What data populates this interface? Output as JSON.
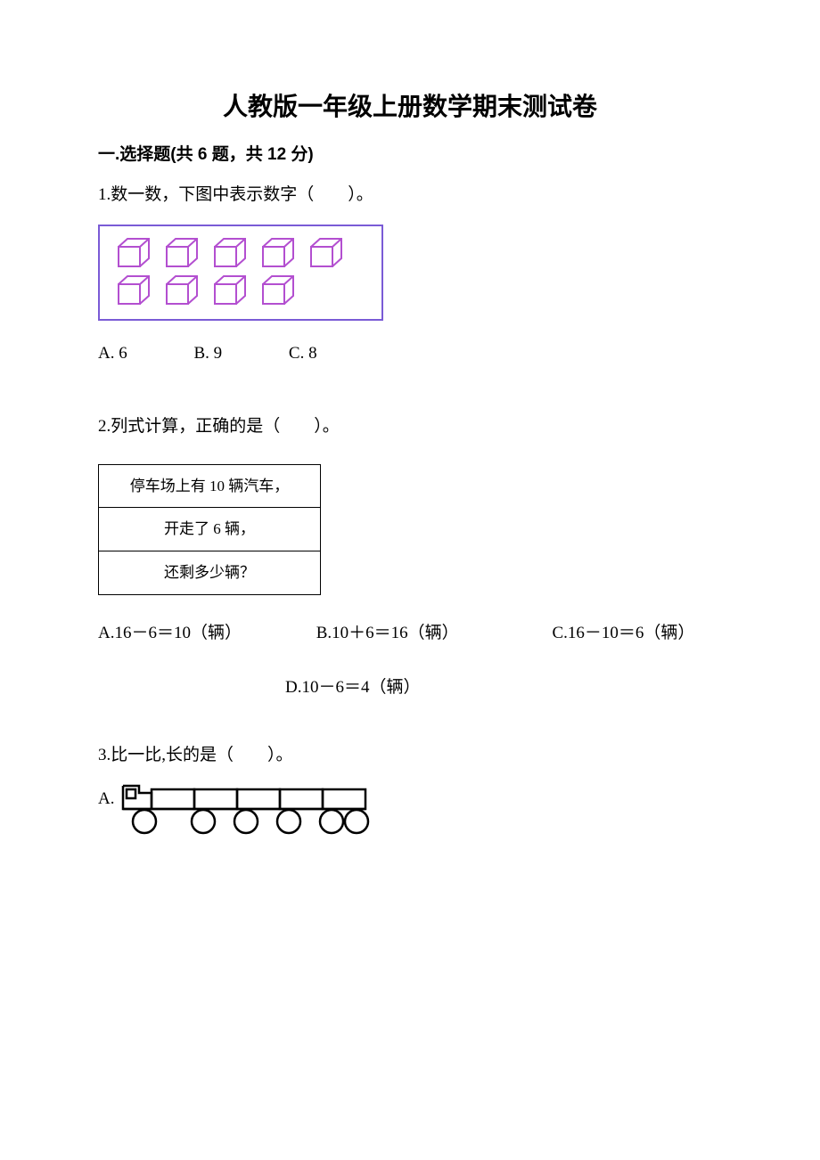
{
  "title": "人教版一年级上册数学期末测试卷",
  "section1": {
    "heading": "一.选择题(共 6 题，共 12 分)"
  },
  "q1": {
    "stem": "1.数一数，下图中表示数字（　　）。",
    "cubes": {
      "row1_count": 5,
      "row2_count": 4
    },
    "optA": "A. 6",
    "optB": "B. 9",
    "optC": "C. 8"
  },
  "q2": {
    "stem": "2.列式计算，正确的是（　　）。",
    "table": {
      "r1": "停车场上有 10 辆汽车，",
      "r2": "开走了 6 辆，",
      "r3": "还剩多少辆？"
    },
    "optA": "A.16－6＝10（辆）",
    "optB": "B.10＋6＝16（辆）",
    "optC": "C.16－10＝6（辆）",
    "optD": "D.10－6＝4（辆）"
  },
  "q3": {
    "stem": "3.比一比,长的是（　　）。",
    "optA_label": "A."
  }
}
